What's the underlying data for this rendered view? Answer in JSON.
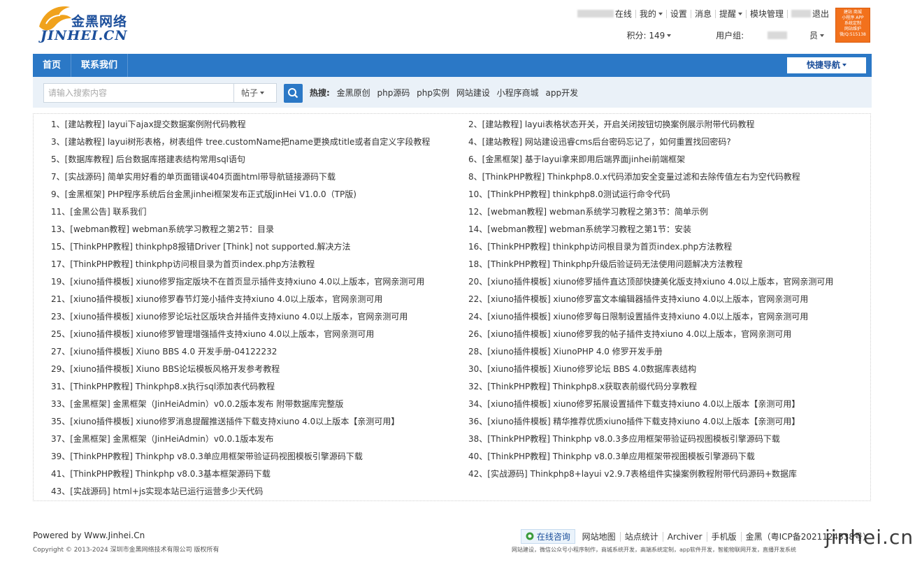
{
  "header": {
    "logo_cn": "金黑网络",
    "logo_en": "JINHEI.CN",
    "top_links": [
      {
        "label": "在线",
        "caret": false,
        "blurred": true
      },
      {
        "label": "我的",
        "caret": true
      },
      {
        "label": "设置",
        "caret": false
      },
      {
        "label": "消息",
        "caret": false
      },
      {
        "label": "提醒",
        "caret": true
      },
      {
        "label": "模块管理",
        "caret": false
      },
      {
        "label": "退出",
        "caret": false,
        "blurred": true
      }
    ],
    "points_label": "积分: 149",
    "usergroup_label": "用户组:",
    "usergroup_value": "员",
    "badge_lines": [
      "建站 商城",
      "小程序 APP",
      "系统定制",
      "网站维护",
      "微/Q:515138"
    ]
  },
  "main_nav": {
    "items": [
      "首页",
      "联系我们"
    ],
    "quick_nav": "快捷导航"
  },
  "search": {
    "placeholder": "请输入搜索内容",
    "type": "帖子",
    "hot_label": "热搜:",
    "hot_terms": [
      "金黑原创",
      "php源码",
      "php实例",
      "网站建设",
      "小程序商城",
      "app开发"
    ]
  },
  "list": {
    "items": [
      "1、[建站教程] layui下ajax提交数据案例附代码教程",
      "2、[建站教程] layui表格状态开关，开启关闭按钮切换案例展示附带代码教程",
      "3、[建站教程] layui树形表格，树表组件 tree.customName把name更换成title或者自定义字段教程",
      "4、[建站教程] 网站建设迅睿cms后台密码忘记了，如何重置找回密码?",
      "5、[数据库教程] 后台数据库搭建表结构常用sql语句",
      "6、[金黑框架] 基于layui拿来即用后端界面jinhei前端框架",
      "7、[实战源码] 简单实用好看的单页面错误404页面html带导航链接源码下载",
      "8、[ThinkPHP教程] Thinkphp8.0.x代码添加安全变量过滤和去除传值左右为空代码教程",
      "9、[金黑框架] PHP程序系统后台金黑jinhei框架发布正式版JinHei V1.0.0（TP版)",
      "10、[ThinkPHP教程] thinkphp8.0测试运行命令代码",
      "11、[金黑公告] 联系我们",
      "12、[webman教程] webman系统学习教程之第3节：简单示例",
      "13、[webman教程] webman系统学习教程之第2节：目录",
      "14、[webman教程] webman系统学习教程之第1节：安装",
      "15、[ThinkPHP教程] thinkphp8报错Driver [Think] not supported.解决方法",
      "16、[ThinkPHP教程] thinkphp访问根目录为首页index.php方法教程",
      "17、[ThinkPHP教程] thinkphp访问根目录为首页index.php方法教程",
      "18、[ThinkPHP教程] Thinkphp升级后验证码无法使用问题解决方法教程",
      "19、[xiuno插件模板] xiuno修罗指定版块不在首页显示插件支持xiuno 4.0以上版本，官网亲测可用",
      "20、[xiuno插件模板] xiuno修罗插件直达顶部快捷美化版支持xiuno 4.0以上版本，官网亲测可用",
      "21、[xiuno插件模板] xiuno修罗春节灯笼小插件支持xiuno 4.0以上版本，官网亲测可用",
      "22、[xiuno插件模板] xiuno修罗富文本编辑器插件支持xiuno 4.0以上版本，官网亲测可用",
      "23、[xiuno插件模板] xiuno修罗论坛社区版块合并插件支持xiuno 4.0以上版本，官网亲测可用",
      "24、[xiuno插件模板] xiuno修罗每日限制设置插件支持xiuno 4.0以上版本，官网亲测可用",
      "25、[xiuno插件模板] xiuno修罗管理增强插件支持xiuno 4.0以上版本，官网亲测可用",
      "26、[xiuno插件模板] xiuno修罗我的帖子插件支持xiuno 4.0以上版本，官网亲测可用",
      "27、[xiuno插件模板] Xiuno BBS 4.0 开发手册-04122232",
      "28、[xiuno插件模板] XiunoPHP 4.0 修罗开发手册",
      "29、[xiuno插件模板] Xiuno BBS论坛模板风格开发参考教程",
      "30、[xiuno插件模板] Xiuno修罗论坛 BBS 4.0数据库表结构",
      "31、[ThinkPHP教程] Thinkphp8.x执行sql添加表代码教程",
      "32、[ThinkPHP教程] Thinkphp8.x获取表前缀代码分享教程",
      "33、[金黑框架] 金黑框架（JinHeiAdmin）v0.0.2版本发布 附带数据库完整版",
      "34、[xiuno插件模板] xiuno修罗拓展设置插件下载支持xiuno 4.0以上版本【亲测可用】",
      "35、[xiuno插件模板] xiuno修罗消息提醒推送插件下载支持xiuno 4.0以上版本【亲测可用】",
      "36、[xiuno插件模板] 精华推荐优质xiuno插件下载支持xiuno 4.0以上版本【亲测可用】",
      "37、[金黑框架] 金黑框架（JinHeiAdmin）v0.0.1版本发布",
      "38、[ThinkPHP教程] Thinkphp v8.0.3多应用框架带验证码视图模板引擎源码下载",
      "39、[ThinkPHP教程] Thinkphp v8.0.3单应用框架带验证码视图模板引擎源码下载",
      "40、[ThinkPHP教程] Thinkphp v8.0.3单应用框架带视图模板引擎源码下载",
      "41、[ThinkPHP教程] Thinkphp v8.0.3基本框架源码下载",
      "42、[实战源码] Thinkphp8+layui v2.9.7表格组件实操案例教程附带代码源码+数据库",
      "43、[实战源码] html+js实现本站已运行运营多少天代码"
    ]
  },
  "footer": {
    "powered": "Powered by Www.Jinhei.Cn",
    "copyright": "Copyright © 2013-2024 深圳市金黑网络技术有限公司 版权所有",
    "consult": "在线咨询",
    "links": [
      "网站地图",
      "站点统计",
      "Archiver",
      "手机版",
      "金黑（粤ICP备2021124338号）"
    ],
    "sub": "网站建设，微信公众号小程序制作，商城系统开发，高端系统定制，app软件开发，智能物联网开发，直播开发系统",
    "watermark": "jinhei.cn"
  },
  "colors": {
    "brand_blue": "#2b78c6",
    "logo_blue": "#1c4f9b",
    "badge_orange": "#f2711c"
  }
}
